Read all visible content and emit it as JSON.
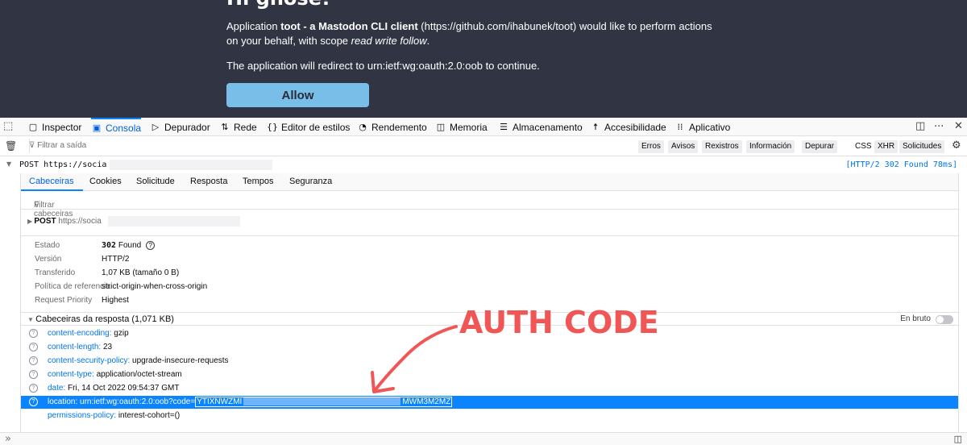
{
  "page": {
    "heading": "Hi ghose!",
    "app_prefix": "Application ",
    "app_name": "toot - a Mastodon CLI client",
    "app_suffix": " (https://github.com/ihabunek/toot) would like to perform actions",
    "scope_prefix": "on your behalf, with scope ",
    "scope": "read write follow",
    "scope_suffix": ".",
    "redirect_text": "The application will redirect to urn:ietf:wg:oauth:2.0:oob to continue.",
    "allow_label": "Allow"
  },
  "toolbox": {
    "tabs": [
      {
        "label": "Inspector",
        "icon": "inspector-icon"
      },
      {
        "label": "Consola",
        "icon": "console-icon"
      },
      {
        "label": "Depurador",
        "icon": "debugger-icon"
      },
      {
        "label": "Rede",
        "icon": "network-icon"
      },
      {
        "label": "Editor de estilos",
        "icon": "style-editor-icon"
      },
      {
        "label": "Rendemento",
        "icon": "performance-icon"
      },
      {
        "label": "Memoria",
        "icon": "memory-icon"
      },
      {
        "label": "Almacenamento",
        "icon": "storage-icon"
      },
      {
        "label": "Accesibilidade",
        "icon": "accessibility-icon"
      },
      {
        "label": "Aplicativo",
        "icon": "application-icon"
      }
    ],
    "active_tab": "Consola",
    "more": "···",
    "close": "✕"
  },
  "filterbar": {
    "placeholder": "Filtrar a saída",
    "levels": [
      "Erros",
      "Avisos",
      "Rexistros",
      "Información",
      "Depurar"
    ],
    "types": [
      "CSS",
      "XHR",
      "Solicitudes"
    ]
  },
  "request": {
    "method_url": "POST https://socia",
    "status": "[HTTP/2 302 Found 78ms]"
  },
  "details": {
    "tabs": [
      "Cabeceiras",
      "Cookies",
      "Solicitude",
      "Resposta",
      "Tempos",
      "Seguranza"
    ],
    "filter_placeholder": "Filtrar cabeceiras",
    "summary_method": "POST",
    "summary_url": "https://socia",
    "info": [
      {
        "key": "Estado",
        "value_bold": "302",
        "value": " Found"
      },
      {
        "key": "Versión",
        "value": "HTTP/2"
      },
      {
        "key": "Transferido",
        "value": "1,07 KB (tamaño 0 B)"
      },
      {
        "key": "Política de referencia",
        "value": "strict-origin-when-cross-origin"
      },
      {
        "key": "Request Priority",
        "value": "Highest"
      }
    ],
    "response_headers_title": "Cabeceiras da resposta (1,071 KB)",
    "raw_label": "En bruto",
    "headers": [
      {
        "name": "content-encoding:",
        "value": "gzip"
      },
      {
        "name": "content-length:",
        "value": "23"
      },
      {
        "name": "content-security-policy:",
        "value": "upgrade-insecure-requests"
      },
      {
        "name": "content-type:",
        "value": "application/octet-stream"
      },
      {
        "name": "date:",
        "value": "Fri, 14 Oct 2022 09:54:37 GMT"
      },
      {
        "name": "location:",
        "value": "urn:ietf:wg:oauth:2.0:oob?code=",
        "code_start": "YTIXNWZMI",
        "code_end": "MWM3M2MZ"
      },
      {
        "name": "permissions-policy:",
        "value": "interest-cohort=()"
      }
    ]
  },
  "annotation": {
    "label": "AUTH CODE",
    "color": "#f05656"
  },
  "statusbar": {
    "chevrons": "»"
  }
}
